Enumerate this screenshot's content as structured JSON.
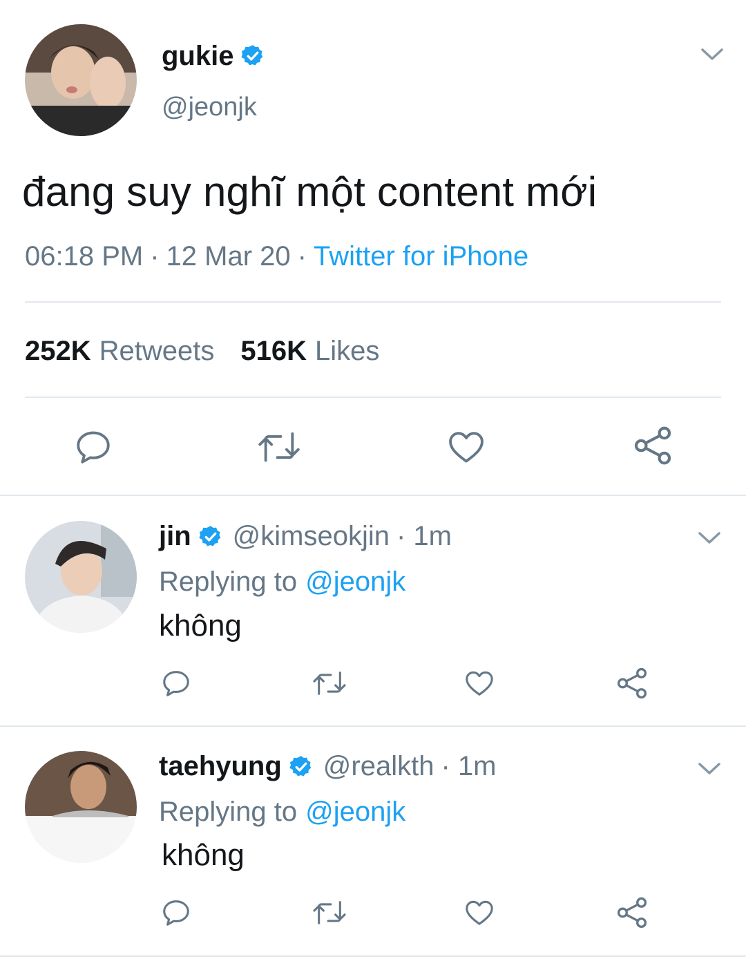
{
  "main_tweet": {
    "display_name": "gukie",
    "handle": "@jeonjk",
    "text": "đang suy nghĩ một content mới",
    "time": "06:18 PM",
    "date": "12 Mar 20",
    "separator": "·",
    "source": "Twitter for iPhone",
    "retweets_count": "252K",
    "retweets_label": "Retweets",
    "likes_count": "516K",
    "likes_label": "Likes"
  },
  "replies": [
    {
      "display_name": "jin",
      "handle": "@kimseokjin",
      "age": "· 1m",
      "replying_label": "Replying to",
      "replying_to": "@jeonjk",
      "text": "không"
    },
    {
      "display_name": "taehyung",
      "handle": "@realkth",
      "age": "· 1m",
      "replying_label": "Replying to",
      "replying_to": "@jeonjk",
      "text": "không"
    }
  ],
  "icons": {
    "verified": "verified-badge-icon",
    "more": "chevron-down-icon",
    "reply": "reply-icon",
    "retweet": "retweet-icon",
    "like": "heart-icon",
    "share": "share-icon"
  },
  "colors": {
    "accent": "#1da1f2",
    "secondary_text": "#657786",
    "divider": "#e1e8ed"
  }
}
